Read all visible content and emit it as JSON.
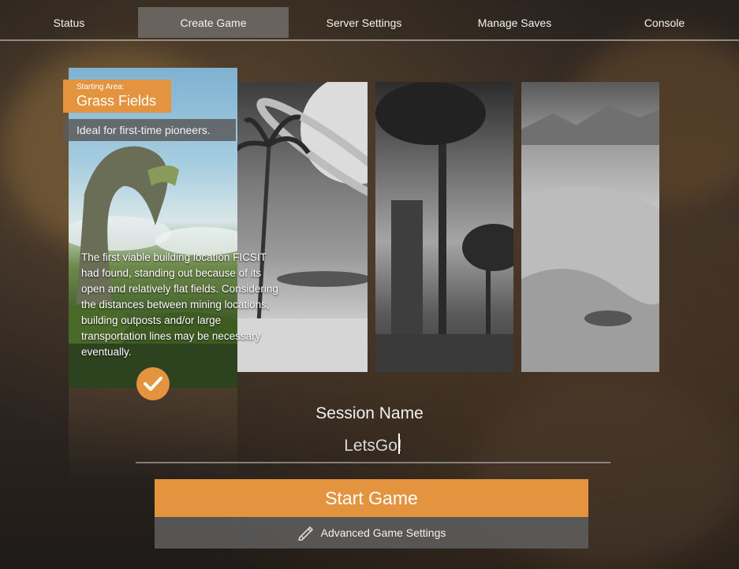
{
  "nav": {
    "tabs": [
      {
        "label": "Status"
      },
      {
        "label": "Create Game"
      },
      {
        "label": "Server Settings"
      },
      {
        "label": "Manage Saves"
      },
      {
        "label": "Console"
      }
    ],
    "active": "Create Game"
  },
  "starting_area": {
    "prefix": "Starting Area:",
    "name": "Grass Fields",
    "tag": "Ideal for first-time pioneers.",
    "description": "The first viable building location FICSIT had found, standing out because of its open and relatively flat fields. Considering the distances between mining locations, building outposts and/or large transportation lines may be necessary eventually."
  },
  "session": {
    "title": "Session Name",
    "value": "LetsGo!"
  },
  "buttons": {
    "start": "Start Game",
    "advanced": "Advanced Game Settings"
  },
  "icons": {
    "check": "check-icon",
    "pencil": "pencil-icon"
  },
  "colors": {
    "accent": "#e4943f",
    "panel_gray": "#5f5f5f"
  }
}
